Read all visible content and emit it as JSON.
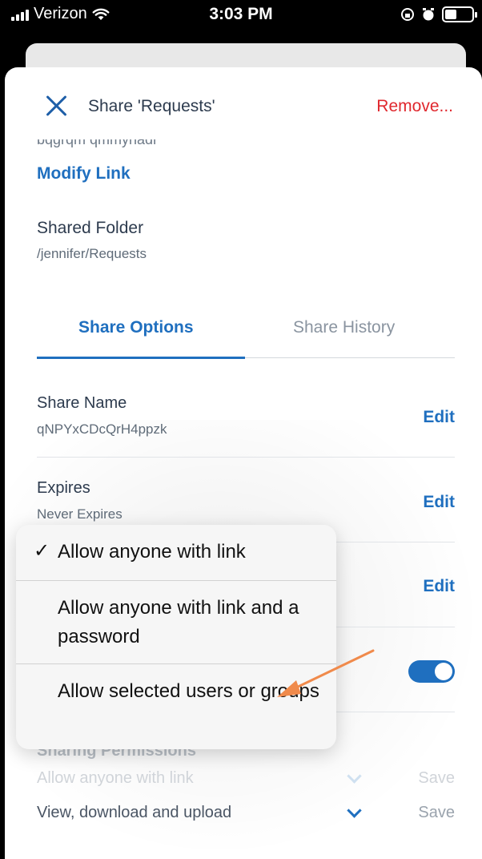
{
  "status_bar": {
    "carrier": "Verizon",
    "time": "3:03 PM"
  },
  "header": {
    "title": "Share 'Requests'",
    "remove_label": "Remove..."
  },
  "link": {
    "partial_text": "bqgrqm qmmynadi",
    "modify_label": "Modify Link"
  },
  "shared_folder": {
    "label": "Shared Folder",
    "path": "/jennifer/Requests"
  },
  "tabs": [
    {
      "label": "Share Options",
      "active": true
    },
    {
      "label": "Share History",
      "active": false
    }
  ],
  "options": {
    "share_name": {
      "label": "Share Name",
      "value": "qNPYxCDcQrH4ppzk",
      "edit": "Edit"
    },
    "expires": {
      "label": "Expires",
      "value": "Never Expires",
      "edit": "Edit"
    },
    "access_edit": "Edit",
    "toggle_on": true
  },
  "sharing_permissions": {
    "label": "Sharing Permissions",
    "rows": [
      {
        "text": "Allow anyone with link",
        "save": "Save"
      },
      {
        "text": "View, download and upload",
        "save": "Save"
      }
    ]
  },
  "popup_menu": {
    "items": [
      {
        "label": "Allow anyone with link",
        "checked": true
      },
      {
        "label": "Allow anyone with link and a password",
        "checked": false
      },
      {
        "label": "Allow selected users or groups",
        "checked": false
      }
    ],
    "check_glyph": "✓"
  },
  "colors": {
    "accent": "#1f6fbf",
    "danger": "#e0282e",
    "annotation": "#f08a4b"
  }
}
